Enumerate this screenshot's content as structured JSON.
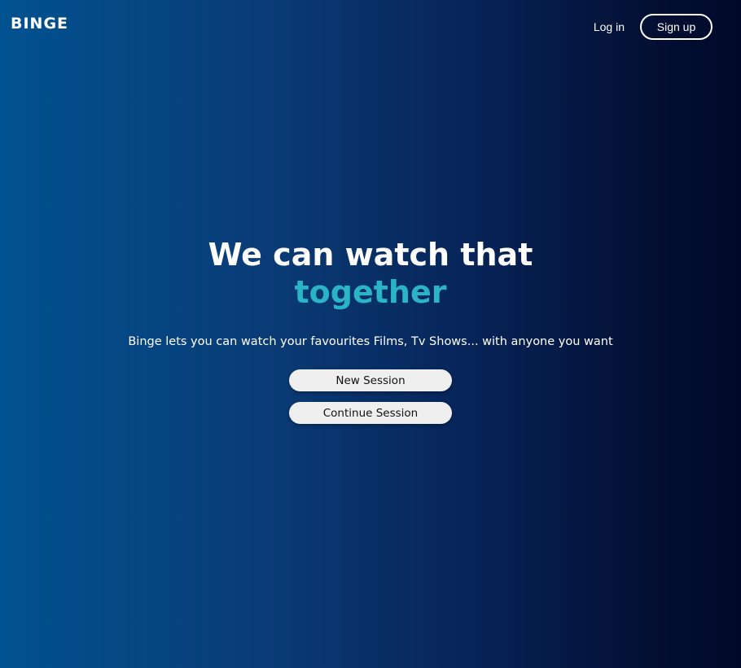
{
  "header": {
    "logo": "BINGE",
    "login_label": "Log in",
    "signup_label": "Sign up"
  },
  "hero": {
    "title_line1": "We can watch that",
    "title_line2": "together",
    "subtitle": "Binge lets you can watch your favourites Films, Tv Shows... with anyone you want"
  },
  "actions": {
    "new_session_label": "New Session",
    "continue_session_label": "Continue Session"
  },
  "colors": {
    "accent": "#2ab4c7",
    "gradient_start": "#015290",
    "gradient_end": "#01092a",
    "button_bg": "#efefef"
  }
}
